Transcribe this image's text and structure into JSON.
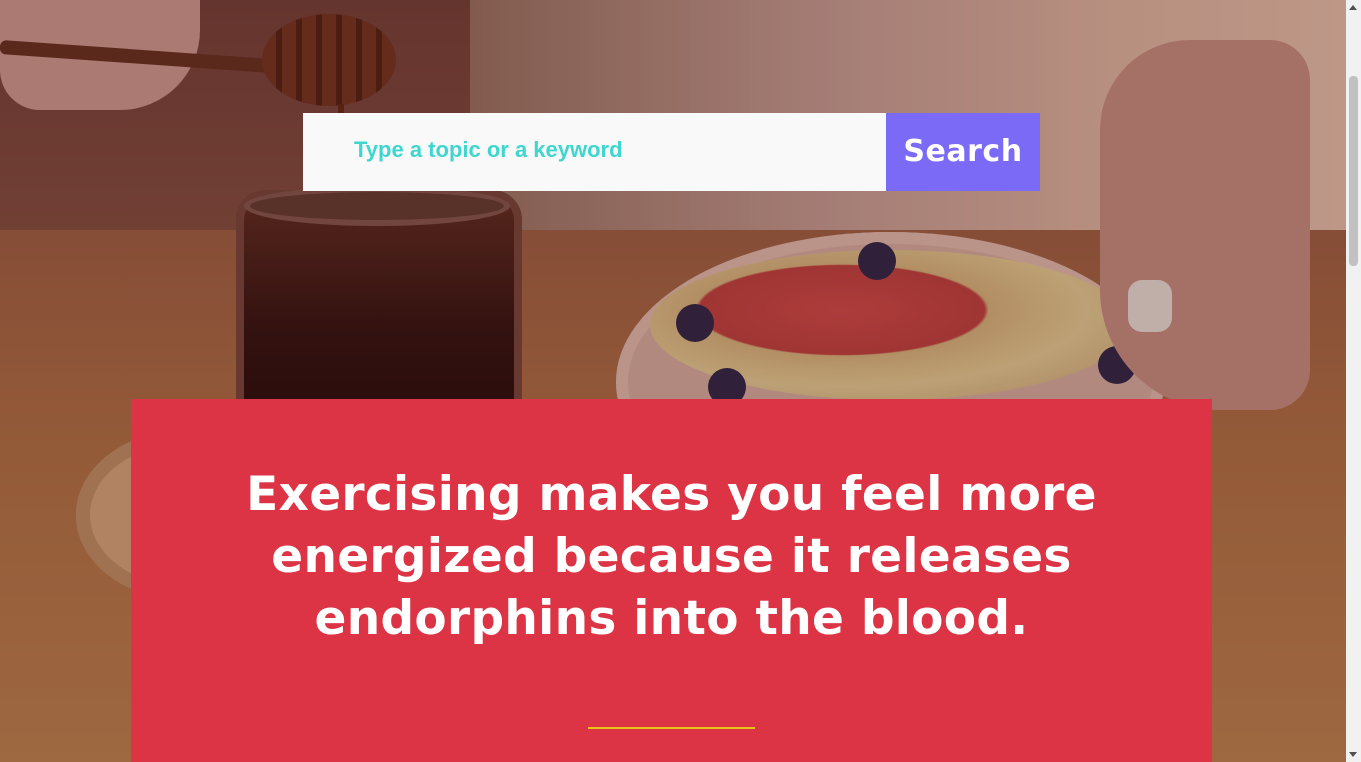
{
  "search": {
    "placeholder": "Type a topic or a keyword",
    "value": "",
    "button_label": "Search"
  },
  "card": {
    "quote": "Exercising makes you feel more energized because it releases endorphins into the blood."
  },
  "colors": {
    "search_button": "#7b6af5",
    "placeholder": "#3fd6cf",
    "card_background": "#dc3445",
    "divider": "#e8c41a"
  },
  "background_image": {
    "icon": "honey-jar-and-fruit-bowl-photo"
  }
}
